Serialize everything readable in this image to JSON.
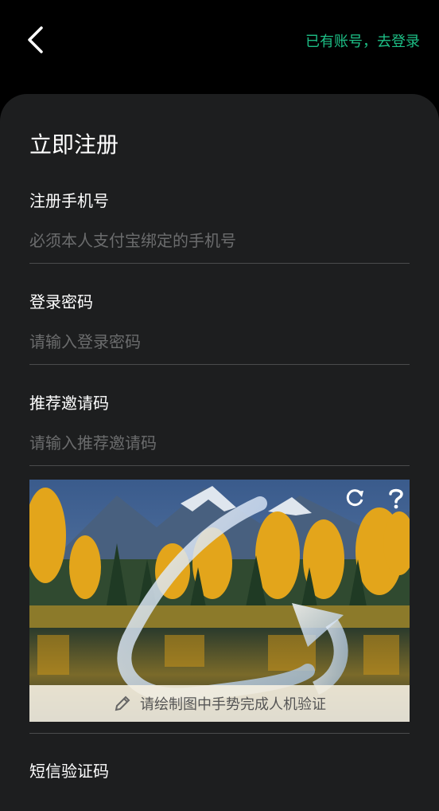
{
  "header": {
    "back_icon": "chevron-left-icon",
    "login_link": "已有账号，去登录",
    "accent_color": "#1dbf86"
  },
  "form": {
    "title": "立即注册",
    "phone": {
      "label": "注册手机号",
      "placeholder": "必须本人支付宝绑定的手机号"
    },
    "password": {
      "label": "登录密码",
      "placeholder": "请输入登录密码"
    },
    "invite": {
      "label": "推荐邀请码",
      "placeholder": "请输入推荐邀请码"
    },
    "captcha": {
      "refresh_icon": "refresh-icon",
      "help_icon": "question-icon",
      "hint_icon": "pencil-icon",
      "hint": "请绘制图中手势完成人机验证"
    },
    "sms": {
      "label": "短信验证码"
    }
  }
}
